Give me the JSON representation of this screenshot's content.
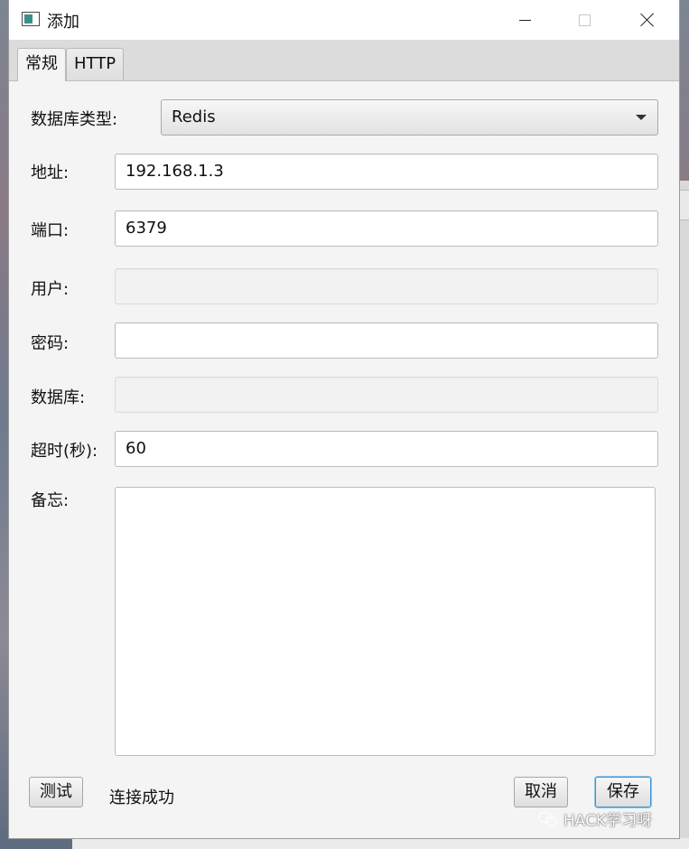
{
  "window": {
    "title": "添加"
  },
  "tabs": [
    {
      "label": "常规",
      "active": true
    },
    {
      "label": "HTTP",
      "active": false
    }
  ],
  "form": {
    "db_type_label": "数据库类型:",
    "db_type_value": "Redis",
    "address_label": "地址:",
    "address_value": "192.168.1.3",
    "port_label": "端口:",
    "port_value": "6379",
    "user_label": "用户:",
    "user_value": "",
    "password_label": "密码:",
    "password_value": "",
    "database_label": "数据库:",
    "database_value": "",
    "timeout_label": "超时(秒):",
    "timeout_value": "60",
    "note_label": "备忘:",
    "note_value": ""
  },
  "footer": {
    "test_label": "测试",
    "status_text": "连接成功",
    "cancel_label": "取消",
    "save_label": "保存"
  },
  "watermark": {
    "text": "HACK学习呀"
  },
  "colors": {
    "window_bg": "#f4f4f4",
    "titlebar_bg": "#ffffff",
    "focus_border": "#3d92d0"
  }
}
